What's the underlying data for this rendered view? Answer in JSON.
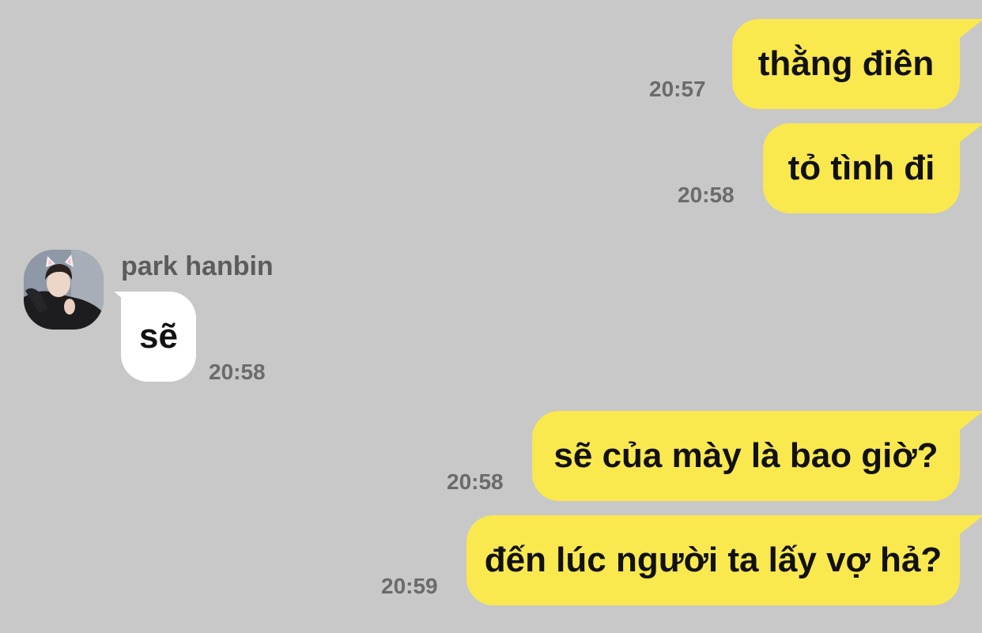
{
  "contact": {
    "name": "park hanbin"
  },
  "messages": [
    {
      "direction": "sent",
      "text": "thằng điên",
      "time": "20:57"
    },
    {
      "direction": "sent",
      "text": "tỏ tình đi",
      "time": "20:58"
    },
    {
      "direction": "received",
      "text": "sẽ",
      "time": "20:58"
    },
    {
      "direction": "sent",
      "text": "sẽ của mày là bao giờ?",
      "time": "20:58"
    },
    {
      "direction": "sent",
      "text": "đến lúc người ta lấy vợ hả?",
      "time": "20:59"
    }
  ],
  "colors": {
    "background": "#c8c8c8",
    "sent_bubble": "#fae84f",
    "received_bubble": "#ffffff",
    "timestamp": "#6b6b6b",
    "sender_name": "#5c5c5c"
  },
  "icons": {
    "avatar": "profile-photo"
  }
}
